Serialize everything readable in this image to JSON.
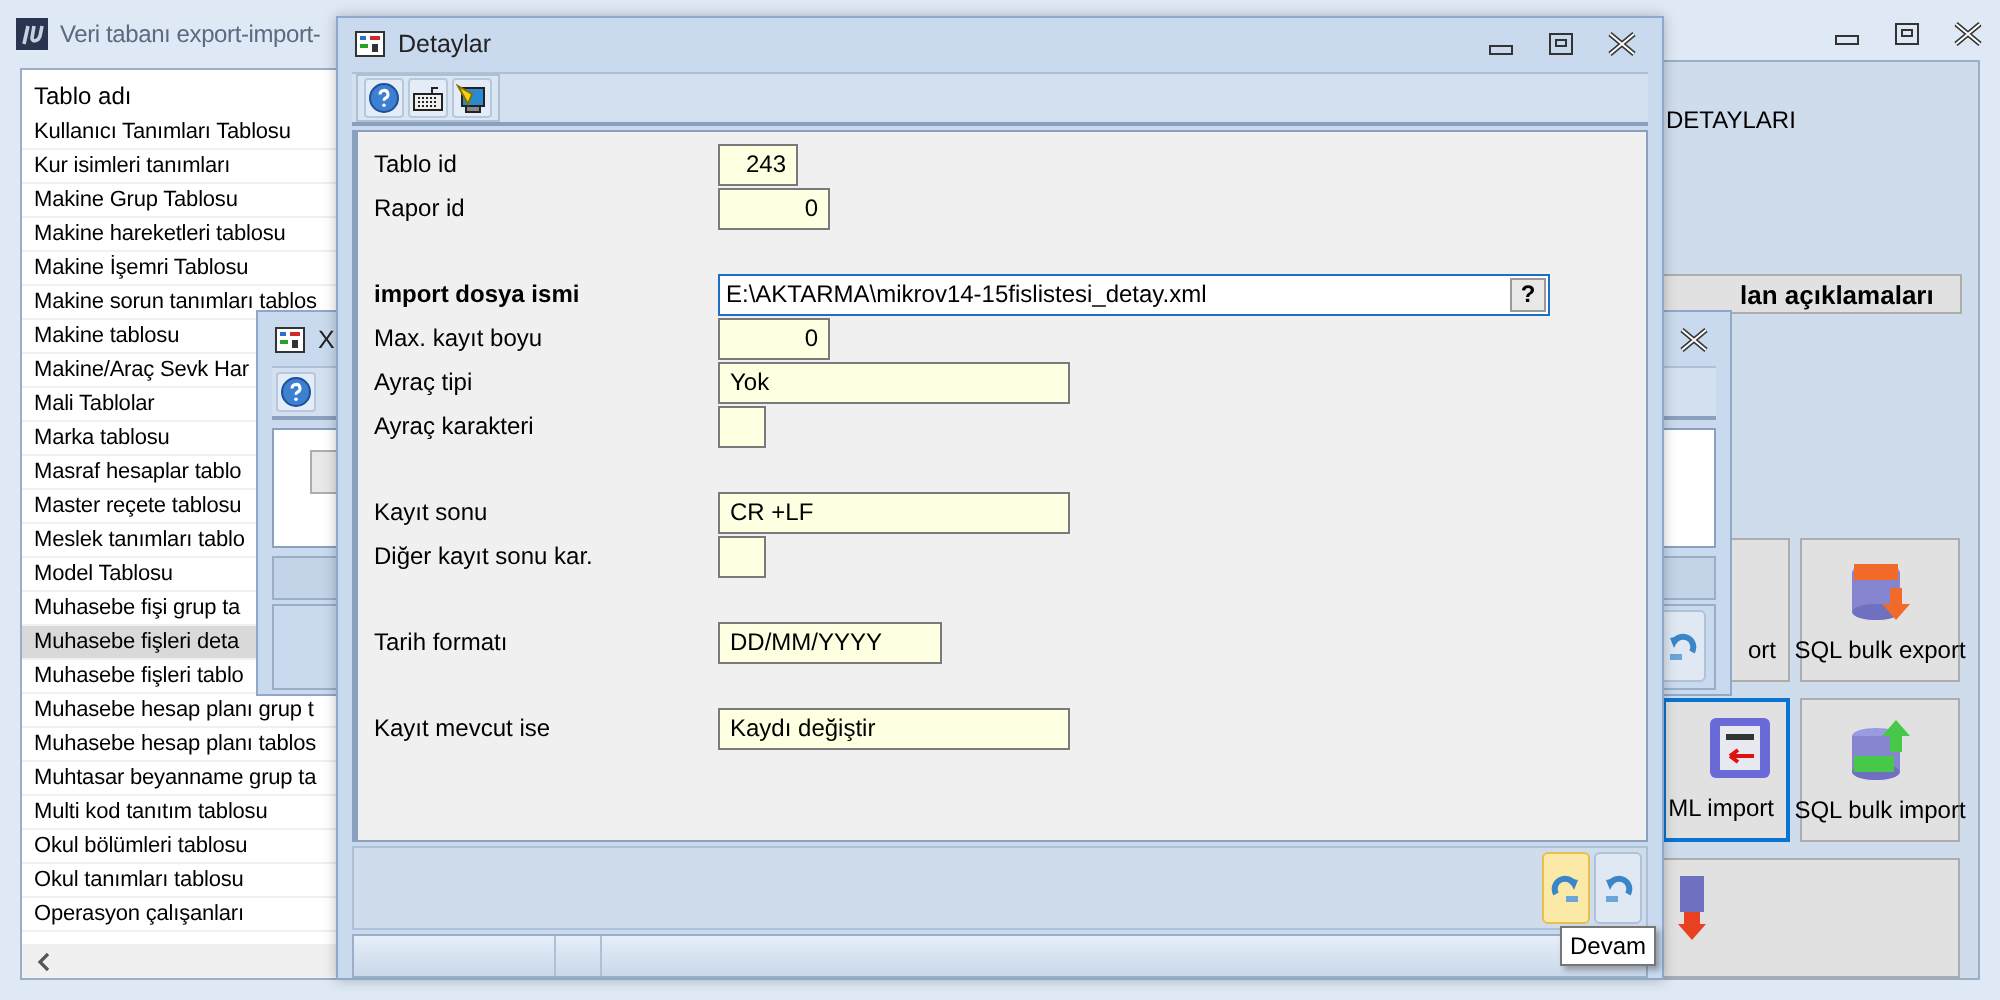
{
  "main_window": {
    "title": "Veri tabanı export-import-",
    "list": {
      "header": "Tablo adı",
      "items": [
        {
          "label": "Kullanıcı Tanımları Tablosu",
          "selected": false
        },
        {
          "label": "Kur isimleri tanımları",
          "selected": false
        },
        {
          "label": "Makine Grup Tablosu",
          "selected": false
        },
        {
          "label": "Makine hareketleri tablosu",
          "selected": false
        },
        {
          "label": "Makine İşemri Tablosu",
          "selected": false
        },
        {
          "label": "Makine sorun tanımları tablos",
          "selected": false
        },
        {
          "label": "Makine tablosu",
          "selected": false
        },
        {
          "label": "Makine/Araç Sevk Har",
          "selected": false
        },
        {
          "label": "Mali Tablolar",
          "selected": false
        },
        {
          "label": "Marka tablosu",
          "selected": false
        },
        {
          "label": "Masraf hesaplar tablo",
          "selected": false
        },
        {
          "label": "Master reçete tablosu",
          "selected": false
        },
        {
          "label": "Meslek tanımları tablo",
          "selected": false
        },
        {
          "label": "Model Tablosu",
          "selected": false
        },
        {
          "label": "Muhasebe fişi grup ta",
          "selected": false
        },
        {
          "label": "Muhasebe fişleri deta",
          "selected": true
        },
        {
          "label": "Muhasebe fişleri tablo",
          "selected": false
        },
        {
          "label": "Muhasebe hesap planı grup t",
          "selected": false
        },
        {
          "label": "Muhasebe hesap planı tablos",
          "selected": false
        },
        {
          "label": "Muhtasar beyanname grup ta",
          "selected": false
        },
        {
          "label": "Multi kod tanıtım tablosu",
          "selected": false
        },
        {
          "label": "Okul bölümleri tablosu",
          "selected": false
        },
        {
          "label": "Okul tanımları tablosu",
          "selected": false
        },
        {
          "label": "Operasyon çalışanları",
          "selected": false
        }
      ]
    },
    "right_panel": {
      "heading": "DETAYLARI",
      "fields_button": "lan açıklamaları",
      "tiles": [
        {
          "label": "ort",
          "kind": "xml-export",
          "selected": false
        },
        {
          "label": "SQL bulk export",
          "kind": "sql-export",
          "selected": false
        },
        {
          "label": "ML import",
          "kind": "xml-import",
          "selected": true
        },
        {
          "label": "SQL bulk import",
          "kind": "sql-import",
          "selected": false
        },
        {
          "kind": "combined-export",
          "selected": false
        }
      ]
    }
  },
  "xml_window": {
    "title": "X"
  },
  "detail_window": {
    "title": "Detaylar",
    "tooltip": "Devam",
    "sections": [
      [
        {
          "label": "Tablo id",
          "kind": "id",
          "value": "243"
        },
        {
          "label": "Rapor id",
          "kind": "number",
          "value": "0"
        }
      ],
      [
        {
          "label": "import dosya ismi",
          "kind": "file",
          "value": "E:\\AKTARMA\\mikrov14-15fislistesi_detay.xml",
          "button": "?"
        },
        {
          "label": "Max. kayıt boyu",
          "kind": "number",
          "value": "0"
        },
        {
          "label": "Ayraç tipi",
          "kind": "text",
          "value": "Yok"
        },
        {
          "label": "Ayraç karakteri",
          "kind": "char"
        }
      ],
      [
        {
          "label": "Kayıt sonu",
          "kind": "text",
          "value": "CR +LF"
        },
        {
          "label": "Diğer kayıt sonu kar.",
          "kind": "char"
        }
      ],
      [
        {
          "label": "Tarih formatı",
          "kind": "date",
          "value": "DD/MM/YYYY"
        }
      ],
      [
        {
          "label": "Kayıt mevcut ise",
          "kind": "text",
          "value": "Kaydı değiştir"
        }
      ]
    ]
  }
}
